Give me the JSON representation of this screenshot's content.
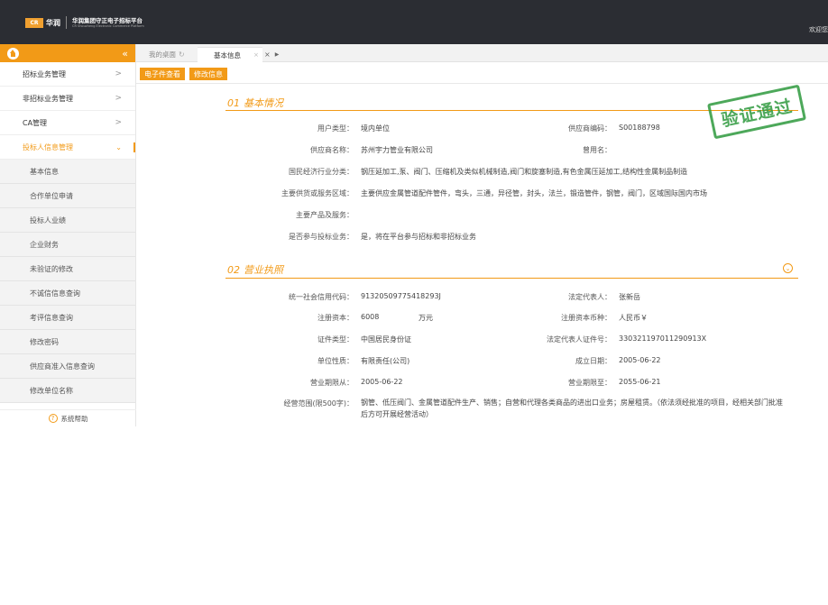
{
  "header": {
    "logo_mark": "CR",
    "logo_cn": "华润",
    "platform_name": "华润集团守正电子招标平台",
    "platform_en": "CR Shouzheng Electronic Commerce Platform",
    "welcome": "欢迎您"
  },
  "sidebar": {
    "items": [
      {
        "label": "招标业务管理",
        "arrow": ">"
      },
      {
        "label": "非招标业务管理",
        "arrow": ">"
      },
      {
        "label": "CA管理",
        "arrow": ">"
      },
      {
        "label": "投标人信息管理",
        "arrow": "⌄"
      }
    ],
    "sub_items": [
      "基本信息",
      "合作单位申请",
      "投标人业绩",
      "企业财务",
      "未验证的修改",
      "不诚信信息查询",
      "考评信息查询",
      "修改密码",
      "供应商准入信息查询",
      "修改单位名称"
    ],
    "help_label": "系统帮助"
  },
  "tabs": {
    "desk": "我的桌面",
    "info": "基本信息"
  },
  "toolbar": {
    "btn_efile": "电子件查看",
    "btn_edit": "修改信息"
  },
  "stamp_text": "验证通过",
  "section1": {
    "num": "01",
    "title": "基本情况",
    "user_type_label": "用户类型：",
    "user_type": "境内单位",
    "supplier_code_label": "供应商编码：",
    "supplier_code": "S00188798",
    "supplier_name_label": "供应商名称：",
    "supplier_name": "苏州宇力管业有限公司",
    "former_name_label": "曾用名：",
    "former_name": "",
    "industry_label": "国民经济行业分类：",
    "industry": "钢压延加工,泵、阀门、压缩机及类似机械制造,阀门和旋塞制造,有色金属压延加工,结构性金属制品制造",
    "area_label": "主要供货或服务区域：",
    "area": "主要供应金属管道配件管件，弯头，三通，异径管，封头，法兰，锻造管件，钢管，阀门，区域国际国内市场",
    "products_label": "主要产品及服务：",
    "products": "",
    "bidding_label": "是否参与投标业务：",
    "bidding": "是，将在平台参与招标和非招标业务"
  },
  "section2": {
    "num": "02",
    "title": "营业执照",
    "credit_code_label": "统一社会信用代码：",
    "credit_code": "91320509775418293J",
    "legal_rep_label": "法定代表人：",
    "legal_rep": "张新岳",
    "capital_label": "注册资本：",
    "capital": "6008",
    "capital_unit": "万元",
    "currency_label": "注册资本币种：",
    "currency": "人民币￥",
    "id_type_label": "证件类型：",
    "id_type": "中国居民身份证",
    "id_number_label": "法定代表人证件号：",
    "id_number": "330321197011290913X",
    "nature_label": "单位性质：",
    "nature": "有限责任(公司)",
    "founded_label": "成立日期：",
    "founded": "2005-06-22",
    "term_from_label": "营业期限从：",
    "term_from": "2005-06-22",
    "term_to_label": "营业期限至：",
    "term_to": "2055-06-21",
    "scope_label": "经营范围(限500字)：",
    "scope": "钢管、低压阀门、金属管道配件生产、销售；自营和代理各类商品的进出口业务；房屋租赁。（依法须经批准的项目，经相关部门批准后方可开展经营活动）"
  }
}
